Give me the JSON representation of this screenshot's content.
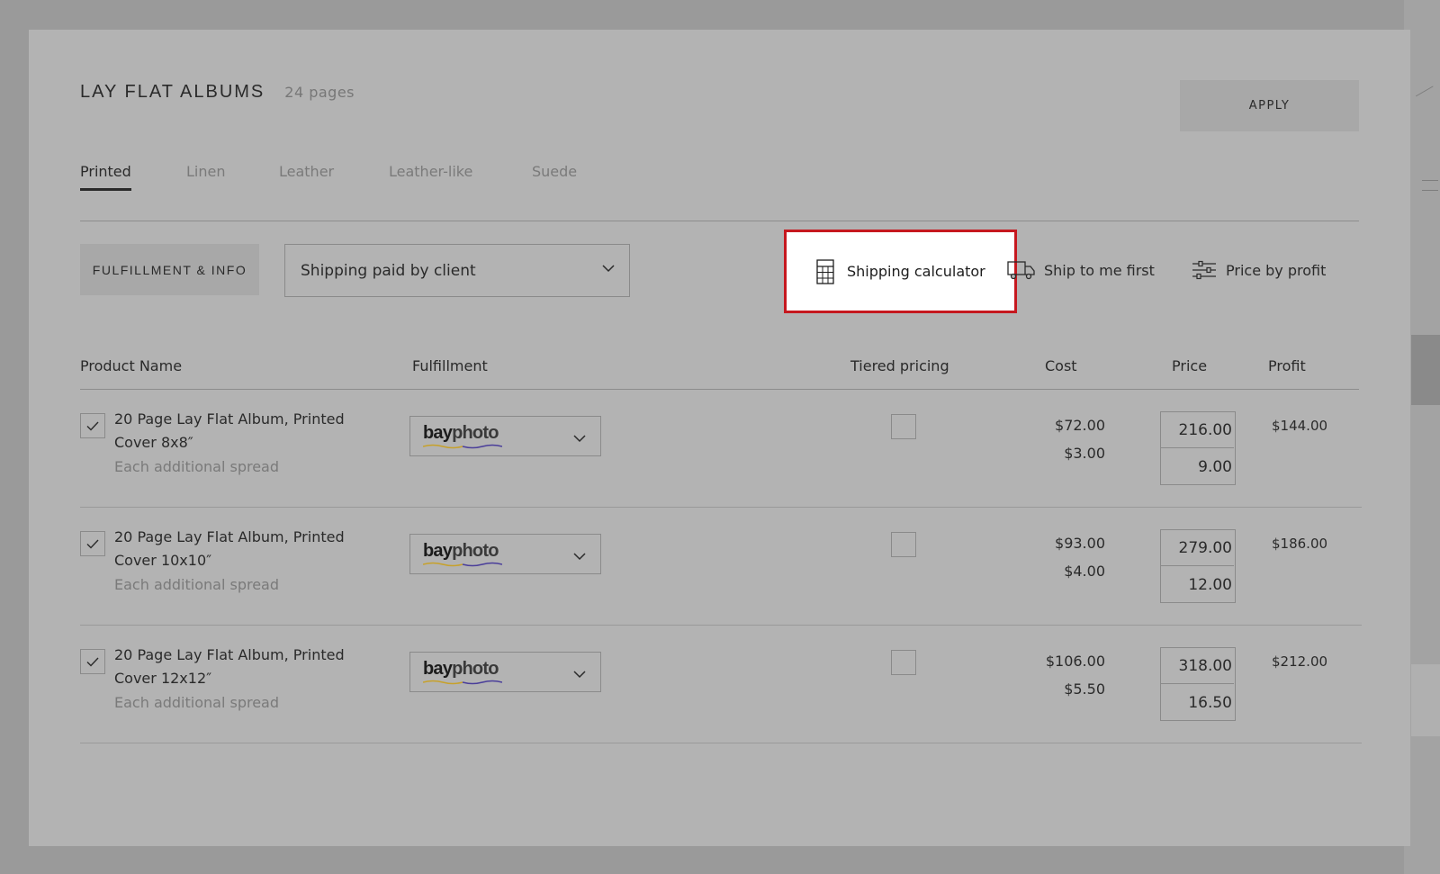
{
  "header": {
    "title": "LAY FLAT ALBUMS",
    "subtitle": "24 pages",
    "apply_label": "APPLY"
  },
  "tabs": [
    {
      "label": "Printed",
      "active": true
    },
    {
      "label": "Linen",
      "active": false
    },
    {
      "label": "Leather",
      "active": false
    },
    {
      "label": "Leather-like",
      "active": false
    },
    {
      "label": "Suede",
      "active": false
    }
  ],
  "toolbar": {
    "fulfillment_label": "FULFILLMENT & INFO",
    "shipping_select_value": "Shipping paid by client",
    "shipping_calculator_label": "Shipping calculator",
    "ship_to_me_label": "Ship to me first",
    "price_by_profit_label": "Price by profit"
  },
  "table": {
    "columns": {
      "product_name": "Product Name",
      "fulfillment": "Fulfillment",
      "tiered_pricing": "Tiered pricing",
      "cost": "Cost",
      "price": "Price",
      "profit": "Profit"
    },
    "rows": [
      {
        "checked": true,
        "name": "20 Page Lay Flat Album, Printed Cover 8x8″",
        "sub": "Each additional spread",
        "fulfillment_logo": {
          "bay": "bay",
          "photo": "photo"
        },
        "tiered": false,
        "cost": "$72.00",
        "cost_extra": "$3.00",
        "price": "216.00",
        "price_extra": "9.00",
        "profit": "$144.00"
      },
      {
        "checked": true,
        "name": "20 Page Lay Flat Album, Printed Cover 10x10″",
        "sub": "Each additional spread",
        "fulfillment_logo": {
          "bay": "bay",
          "photo": "photo"
        },
        "tiered": false,
        "cost": "$93.00",
        "cost_extra": "$4.00",
        "price": "279.00",
        "price_extra": "12.00",
        "profit": "$186.00"
      },
      {
        "checked": true,
        "name": "20 Page Lay Flat Album, Printed Cover 12x12″",
        "sub": "Each additional spread",
        "fulfillment_logo": {
          "bay": "bay",
          "photo": "photo"
        },
        "tiered": false,
        "cost": "$106.00",
        "cost_extra": "$5.50",
        "price": "318.00",
        "price_extra": "16.50",
        "profit": "$212.00"
      }
    ]
  },
  "colors": {
    "highlight_border": "#c6181f",
    "overlay": "#9a9a9a",
    "modal_bg": "#b3b3b3"
  },
  "icons": [
    "calculator-icon",
    "truck-icon",
    "sliders-icon",
    "chevron-down-icon",
    "check-icon"
  ]
}
